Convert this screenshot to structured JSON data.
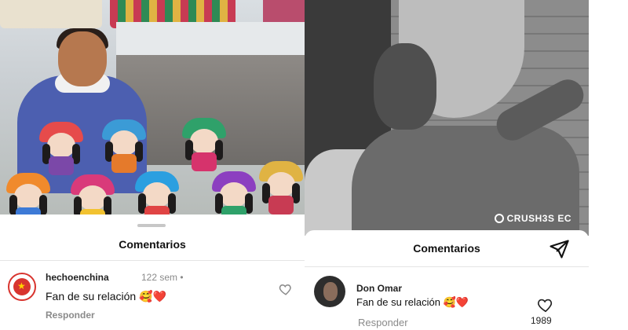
{
  "left_post": {
    "sheet_title": "Comentarios",
    "comment": {
      "username": "hechoenchina",
      "time": "122 sem •",
      "text": "Fan de su relación 🥰❤️",
      "reply_label": "Responder",
      "avatar": "hechoenchina-logo-avatar",
      "like_icon": "heart-outline-icon"
    }
  },
  "right_post": {
    "watermark": "CRUSH3S EC",
    "sheet_title": "Comentarios",
    "share_icon": "send-icon",
    "comment": {
      "username": "Don Omar",
      "text": "Fan de su relación 🥰❤️",
      "reply_label": "Responder",
      "avatar": "don-omar-avatar",
      "like_icon": "heart-outline-icon",
      "like_count": "1989"
    }
  },
  "colors": {
    "sheet_bg": "#ffffff",
    "muted_text": "#8a8a8a",
    "brand_red": "#d8342e"
  }
}
